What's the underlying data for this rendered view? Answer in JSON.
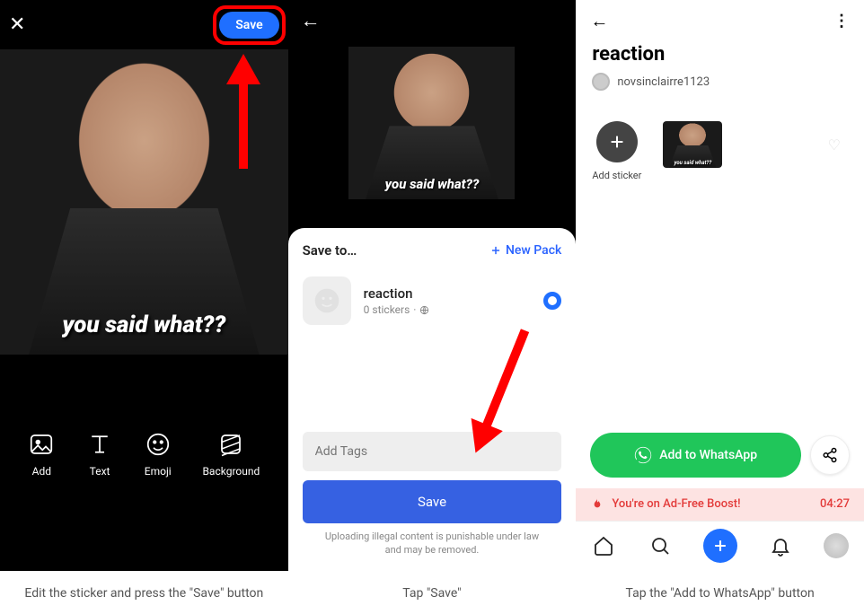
{
  "col1": {
    "save": "Save",
    "sticker_text": "you said what??",
    "tools": {
      "add": "Add",
      "text": "Text",
      "emoji": "Emoji",
      "background": "Background"
    },
    "caption": "Edit the sticker and press the \"Save\" button"
  },
  "col2": {
    "sticker_text": "you said what??",
    "sheet_title": "Save to…",
    "new_pack": "New Pack",
    "pack_name": "reaction",
    "pack_sub": "0 stickers",
    "tags_placeholder": "Add Tags",
    "save_btn": "Save",
    "disclaimer": "Uploading illegal content is punishable under law and may be removed.",
    "caption": "Tap \"Save\""
  },
  "col3": {
    "title": "reaction",
    "username": "novsinclairre1123",
    "add_sticker": "Add sticker",
    "tiny_sticker_text": "you said what??",
    "whatsapp": "Add to WhatsApp",
    "boost_text": "You're on Ad-Free Boost!",
    "boost_time": "04:27",
    "caption": "Tap the \"Add to WhatsApp\" button"
  }
}
